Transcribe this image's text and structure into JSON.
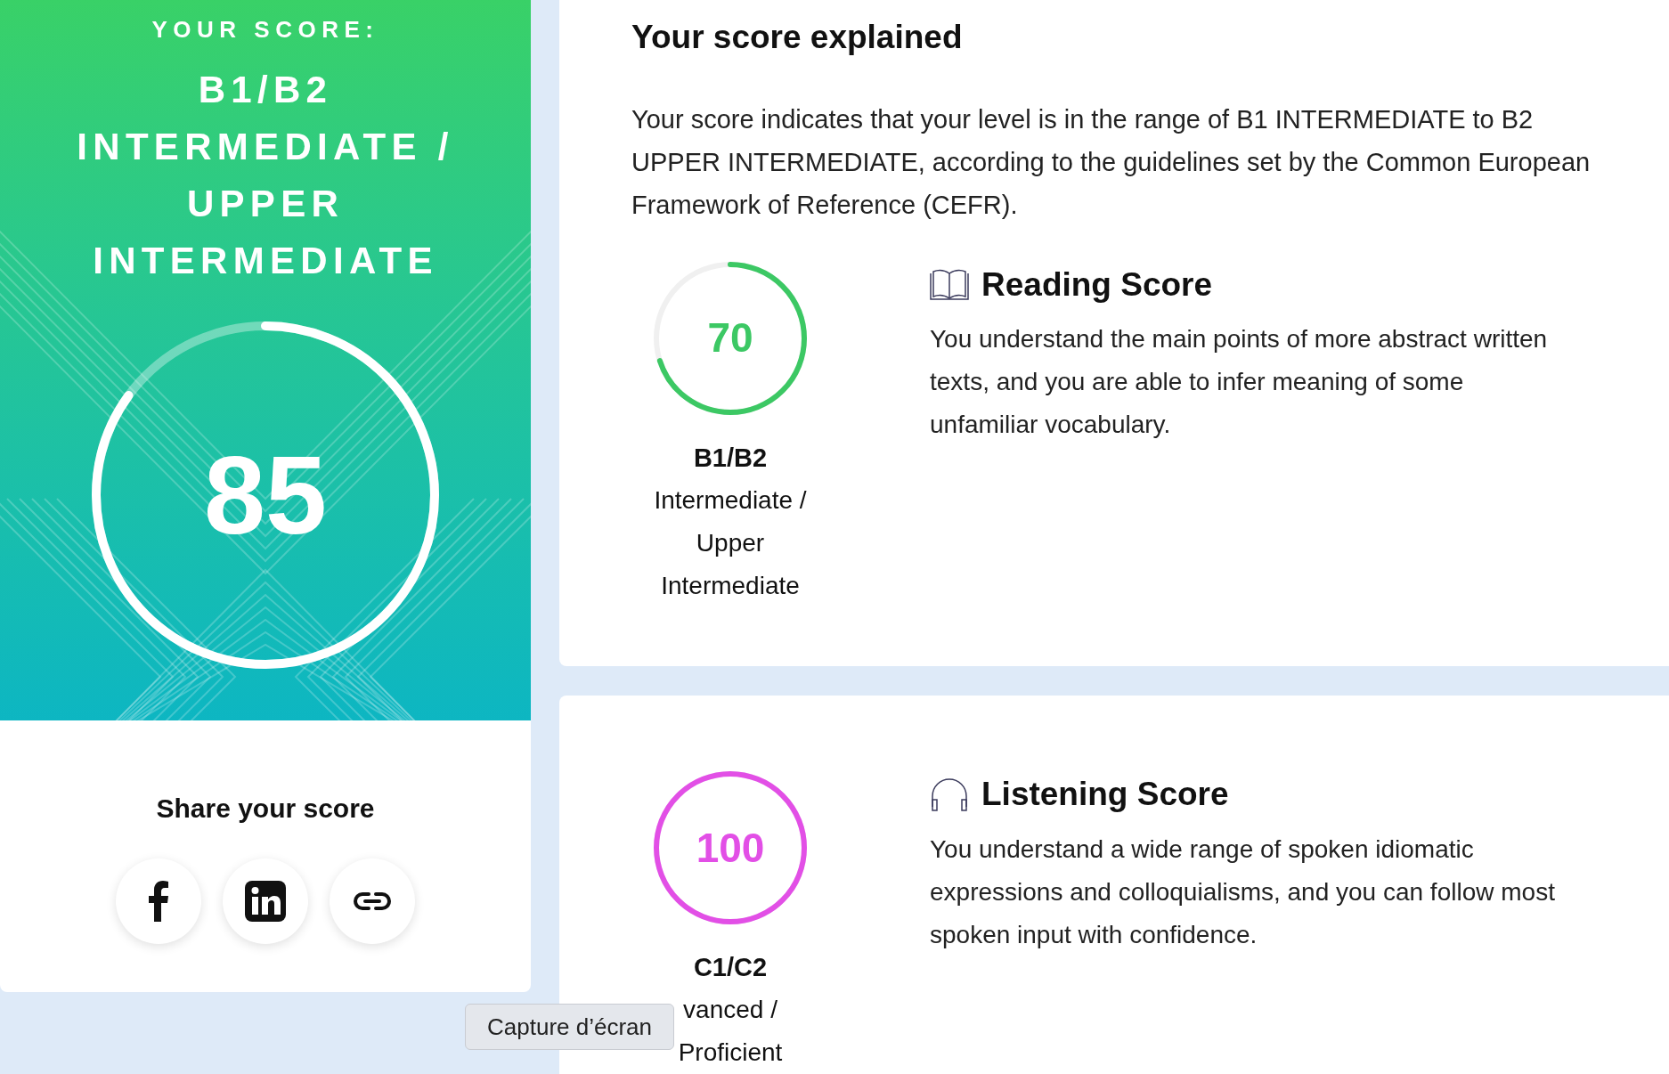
{
  "score_panel": {
    "label": "YOUR SCORE:",
    "level_lines": [
      "B1/B2",
      "INTERMEDIATE /",
      "UPPER",
      "INTERMEDIATE"
    ],
    "score": "85",
    "level": 0.85
  },
  "share": {
    "title": "Share your score",
    "buttons": [
      {
        "kind": "facebook"
      },
      {
        "kind": "linkedin"
      },
      {
        "kind": "link"
      }
    ]
  },
  "explanation": {
    "title": "Your score explained",
    "text": "Your score indicates that your level is in the range of B1 INTERMEDIATE to B2 UPPER INTERMEDIATE, according to the guidelines set by the Common European Framework of Reference (CEFR)."
  },
  "sections": [
    {
      "kind": "reading",
      "score": "70",
      "level": 0.7,
      "color": "#3cc864",
      "grade": "B1/B2",
      "grade_lines": [
        "Intermediate /",
        "Upper",
        "Intermediate"
      ],
      "title": "Reading Score",
      "text": "You understand the main points of more abstract written texts, and you are able to infer meaning of some unfamiliar vocabulary."
    },
    {
      "kind": "listening",
      "score": "100",
      "level": 1,
      "color": "#e24fe6",
      "grade": "C1/C2",
      "grade_lines": [
        "vanced /",
        "Proficient"
      ],
      "title": "Listening Score",
      "text": "You understand a wide range of spoken idiomatic expressions and colloquialisms, and you can follow most spoken input with confidence."
    }
  ],
  "tooltip": {
    "text": "Capture d’écran"
  }
}
